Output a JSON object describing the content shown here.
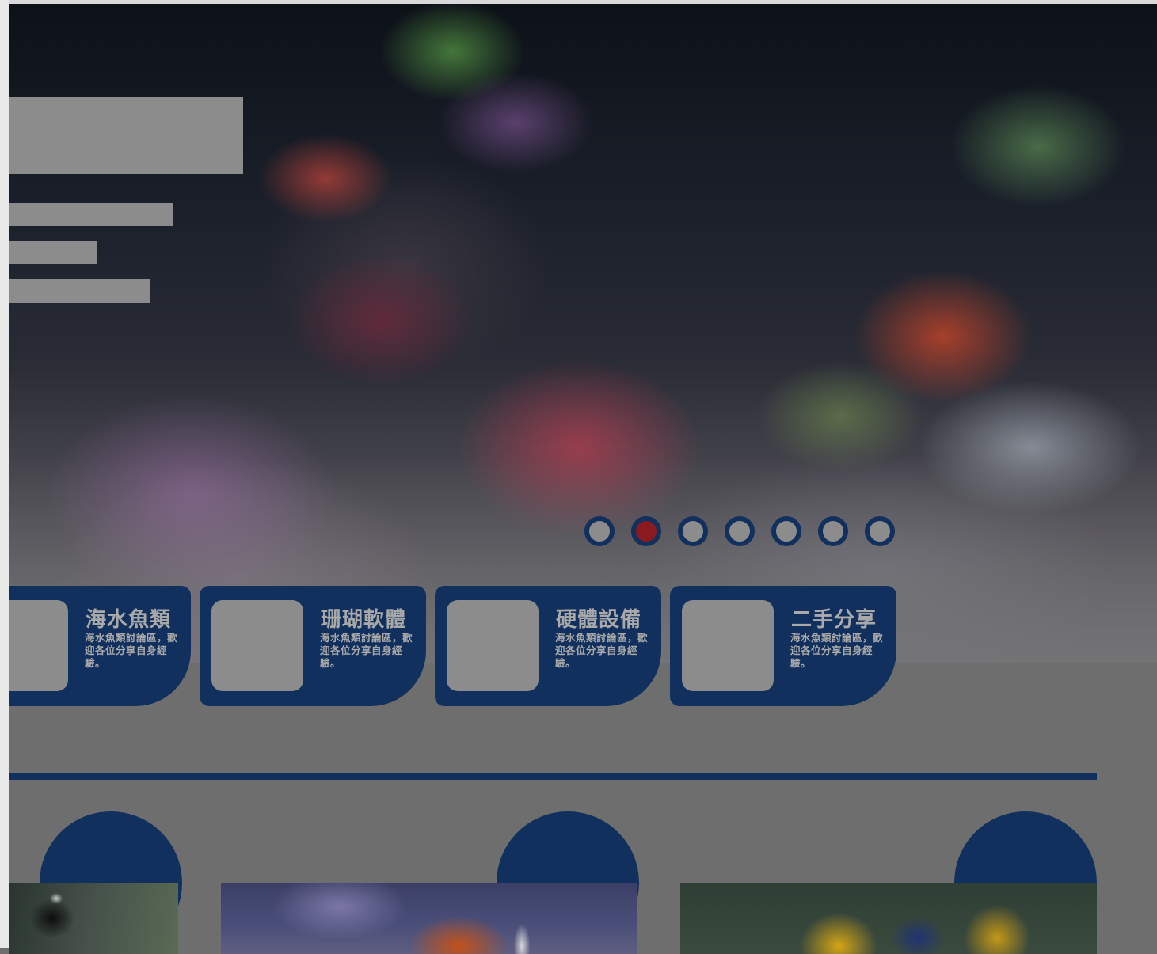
{
  "colors": {
    "navy": "#12305e",
    "placeholder_gray": "#8c8c8c",
    "overlay_gray": "#6e6e6e",
    "active_dot": "#8a1a1e",
    "card_text": "#a9a9a9"
  },
  "carousel": {
    "slide_count": 7,
    "active_index": 1
  },
  "categories": [
    {
      "title": "海水魚類",
      "desc": "海水魚類討論區，歡迎各位分享自身經驗。"
    },
    {
      "title": "珊瑚軟體",
      "desc": "海水魚類討論區，歡迎各位分享自身經驗。"
    },
    {
      "title": "硬體設備",
      "desc": "海水魚類討論區，歡迎各位分享自身經驗。"
    },
    {
      "title": "二手分享",
      "desc": "海水魚類討論區，歡迎各位分享自身經驗。"
    }
  ]
}
